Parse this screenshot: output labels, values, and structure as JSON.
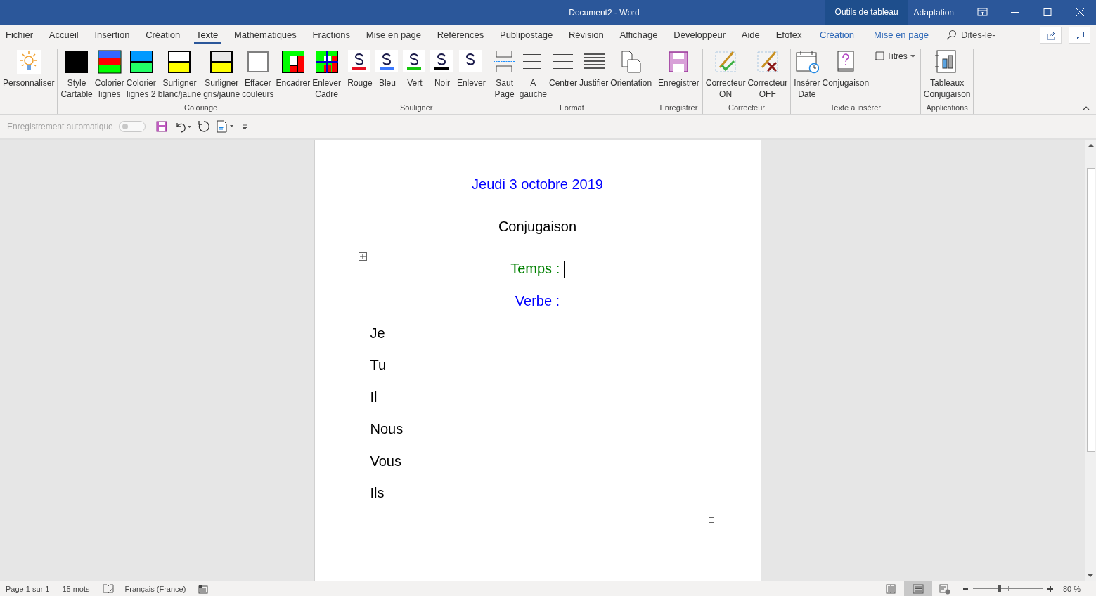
{
  "window": {
    "title": "Document2  -  Word",
    "context_label": "Outils de tableau",
    "account": "Adaptation"
  },
  "tabs": [
    {
      "label": "Fichier",
      "selected": false,
      "kind": "normal"
    },
    {
      "label": "Accueil",
      "selected": false,
      "kind": "normal"
    },
    {
      "label": "Insertion",
      "selected": false,
      "kind": "normal"
    },
    {
      "label": "Création",
      "selected": false,
      "kind": "normal"
    },
    {
      "label": "Texte",
      "selected": true,
      "kind": "normal"
    },
    {
      "label": "Mathématiques",
      "selected": false,
      "kind": "normal"
    },
    {
      "label": "Fractions",
      "selected": false,
      "kind": "normal"
    },
    {
      "label": "Mise en page",
      "selected": false,
      "kind": "normal"
    },
    {
      "label": "Références",
      "selected": false,
      "kind": "normal"
    },
    {
      "label": "Publipostage",
      "selected": false,
      "kind": "normal"
    },
    {
      "label": "Révision",
      "selected": false,
      "kind": "normal"
    },
    {
      "label": "Affichage",
      "selected": false,
      "kind": "normal"
    },
    {
      "label": "Développeur",
      "selected": false,
      "kind": "normal"
    },
    {
      "label": "Aide",
      "selected": false,
      "kind": "normal"
    },
    {
      "label": "Efofex",
      "selected": false,
      "kind": "normal"
    },
    {
      "label": "Création",
      "selected": false,
      "kind": "contextual"
    },
    {
      "label": "Mise en page",
      "selected": false,
      "kind": "contextual"
    }
  ],
  "tell_me": "Dites-le-",
  "ribbon": [
    {
      "items": [
        {
          "label": "Personnaliser",
          "kind": "large"
        }
      ]
    },
    {
      "label": "Coloriage",
      "items": [
        {
          "label": "Style\nCartable",
          "kind": "large"
        },
        {
          "label": "Colorier\nlignes",
          "kind": "large"
        },
        {
          "label": "Colorier\nlignes 2",
          "kind": "large"
        },
        {
          "label": "Surligner\nblanc/jaune",
          "kind": "large"
        },
        {
          "label": "Surligner\ngris/jaune",
          "kind": "large"
        },
        {
          "label": "Effacer\ncouleurs",
          "kind": "large"
        },
        {
          "label": "Encadrer",
          "kind": "large"
        },
        {
          "label": "Enlever\nCadre",
          "kind": "large"
        }
      ]
    },
    {
      "label": "Souligner",
      "items": [
        {
          "label": "Rouge",
          "kind": "large",
          "color": "#e81123"
        },
        {
          "label": "Bleu",
          "kind": "large",
          "color": "#3b78ff"
        },
        {
          "label": "Vert",
          "kind": "large",
          "color": "#16c60c"
        },
        {
          "label": "Noir",
          "kind": "large",
          "color": "#000000"
        },
        {
          "label": "Enlever",
          "kind": "large"
        }
      ]
    },
    {
      "label": "Format",
      "items": [
        {
          "label": "Saut\nPage",
          "kind": "large"
        },
        {
          "label": "A\ngauche",
          "kind": "large"
        },
        {
          "label": "Centrer",
          "kind": "large"
        },
        {
          "label": "Justifier",
          "kind": "large"
        },
        {
          "label": "Orientation",
          "kind": "large"
        }
      ]
    },
    {
      "label": "Enregistrer",
      "items": [
        {
          "label": "Enregistrer",
          "kind": "large"
        }
      ]
    },
    {
      "label": "Correcteur",
      "items": [
        {
          "label": "Correcteur\nON",
          "kind": "large"
        },
        {
          "label": "Correcteur\nOFF",
          "kind": "large"
        }
      ]
    },
    {
      "label": "Texte à insérer",
      "items": [
        {
          "label": "Insérer\nDate",
          "kind": "large"
        },
        {
          "label": "Conjugaison",
          "kind": "large"
        },
        {
          "label": "Titres",
          "kind": "small"
        }
      ]
    },
    {
      "label": "Applications",
      "items": [
        {
          "label": "Tableaux\nConjugaison",
          "kind": "large"
        }
      ]
    }
  ],
  "quick_access": {
    "autosave_label": "Enregistrement automatique",
    "autosave_on": false
  },
  "document": {
    "lines": [
      {
        "text": "Jeudi 3 octobre 2019",
        "kind": "heading",
        "color": "#0000ff"
      },
      {
        "text": "Conjugaison",
        "kind": "heading",
        "color": "#000000"
      },
      {
        "text": "Temps : ",
        "kind": "heading",
        "color": "#008000",
        "cursor": true
      },
      {
        "text": "Verbe :",
        "kind": "heading",
        "color": "#0000ff"
      },
      {
        "text": "Je",
        "kind": "entry",
        "color": "#000000"
      },
      {
        "text": "Tu",
        "kind": "entry",
        "color": "#000000"
      },
      {
        "text": "Il",
        "kind": "entry",
        "color": "#000000"
      },
      {
        "text": "Nous",
        "kind": "entry",
        "color": "#000000"
      },
      {
        "text": "Vous",
        "kind": "entry",
        "color": "#000000"
      },
      {
        "text": "Ils",
        "kind": "entry",
        "color": "#000000"
      }
    ]
  },
  "status_bar": {
    "page": "Page 1 sur 1",
    "words": "15 mots",
    "language": "Français (France)",
    "views": [
      {
        "selected": false
      },
      {
        "selected": true
      },
      {
        "selected": false
      }
    ],
    "zoom": {
      "level": 0.38,
      "reading": "80 %"
    }
  }
}
